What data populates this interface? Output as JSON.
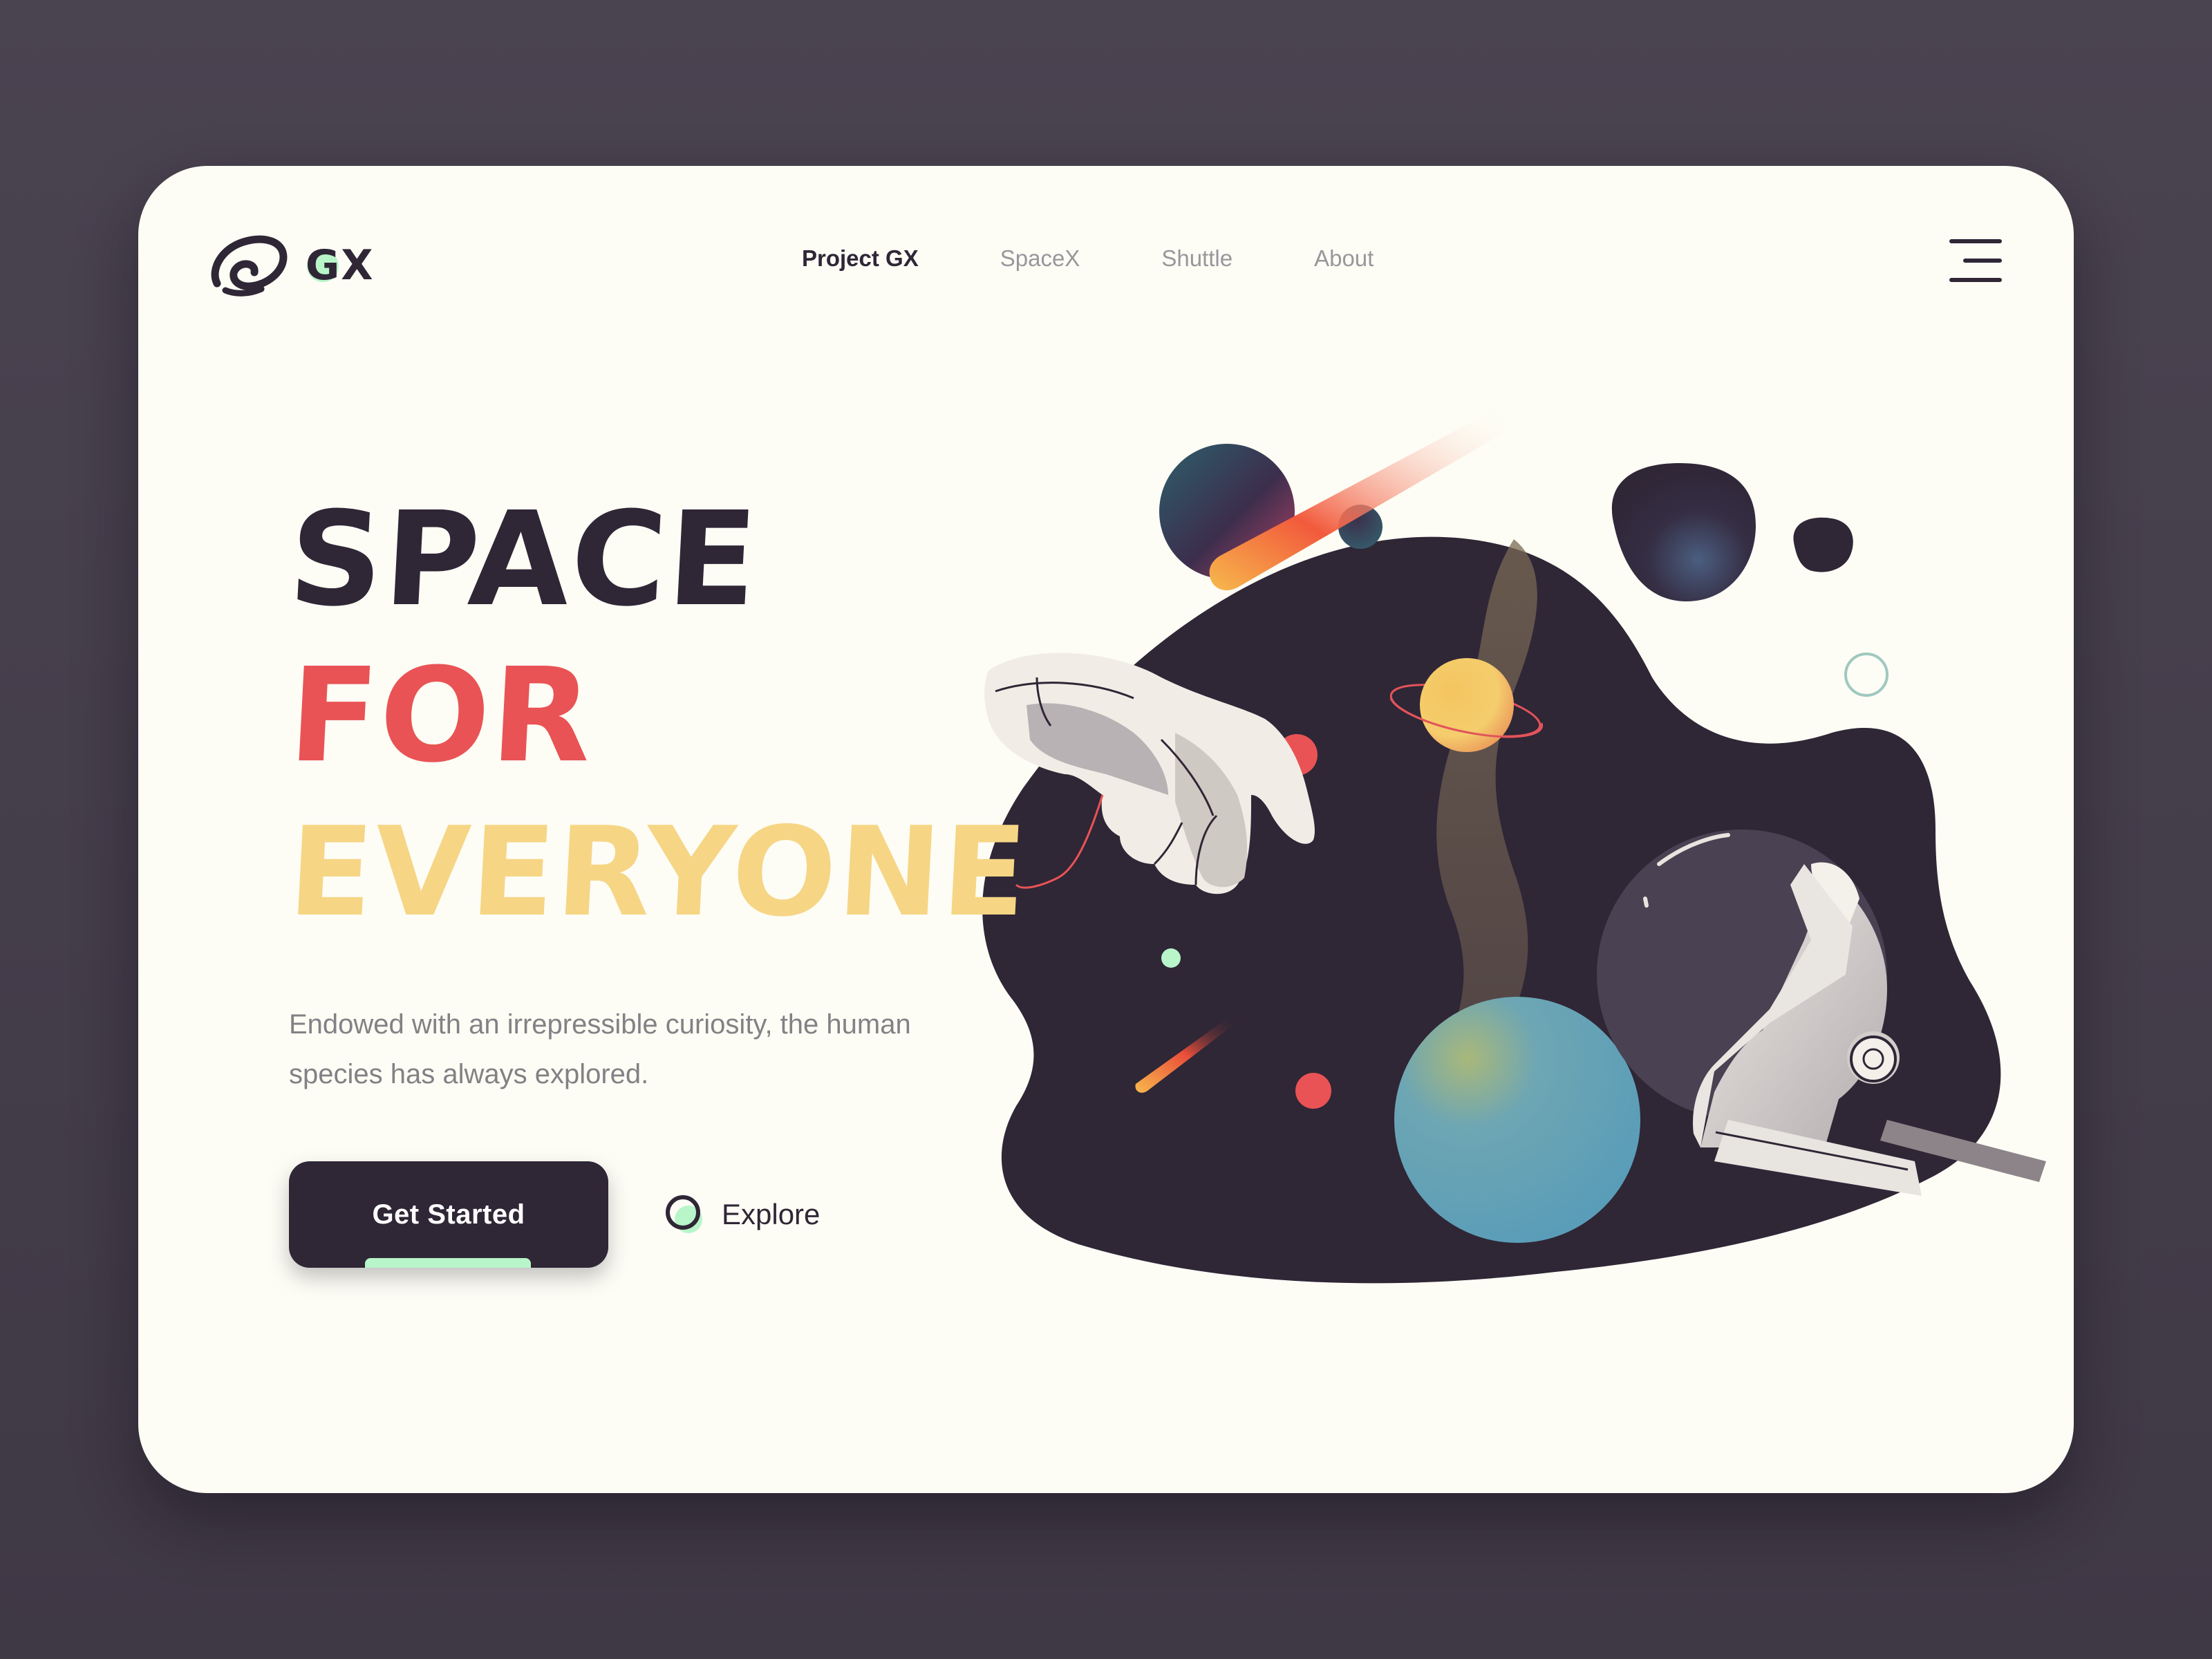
{
  "header": {
    "logo_text": "GX",
    "nav": [
      {
        "label": "Project GX",
        "active": true
      },
      {
        "label": "SpaceX",
        "active": false
      },
      {
        "label": "Shuttle",
        "active": false
      },
      {
        "label": "About",
        "active": false
      }
    ]
  },
  "hero": {
    "headline": [
      "SPACE",
      "FOR",
      "EVERYONE"
    ],
    "body": "Endowed with an irrepressible curiosity, the human species has always explored.",
    "primary_button": "Get Started",
    "secondary_button": "Explore"
  },
  "icons": {
    "logo": "swirl-logo-icon",
    "menu": "hamburger-menu-icon",
    "explore": "ring-icon"
  },
  "colors": {
    "background": "#463f4c",
    "card": "#fdfdf5",
    "dark": "#2f2636",
    "red": "#e95355",
    "yellow": "#f6d585",
    "mint": "#b8f5c9",
    "muted_text": "#848085",
    "nav_inactive": "#9a969c",
    "blue_planet": "#5a9db8"
  },
  "illustration": {
    "subject": "astronaut glove and helmet floating in space blob with planets and comets"
  }
}
